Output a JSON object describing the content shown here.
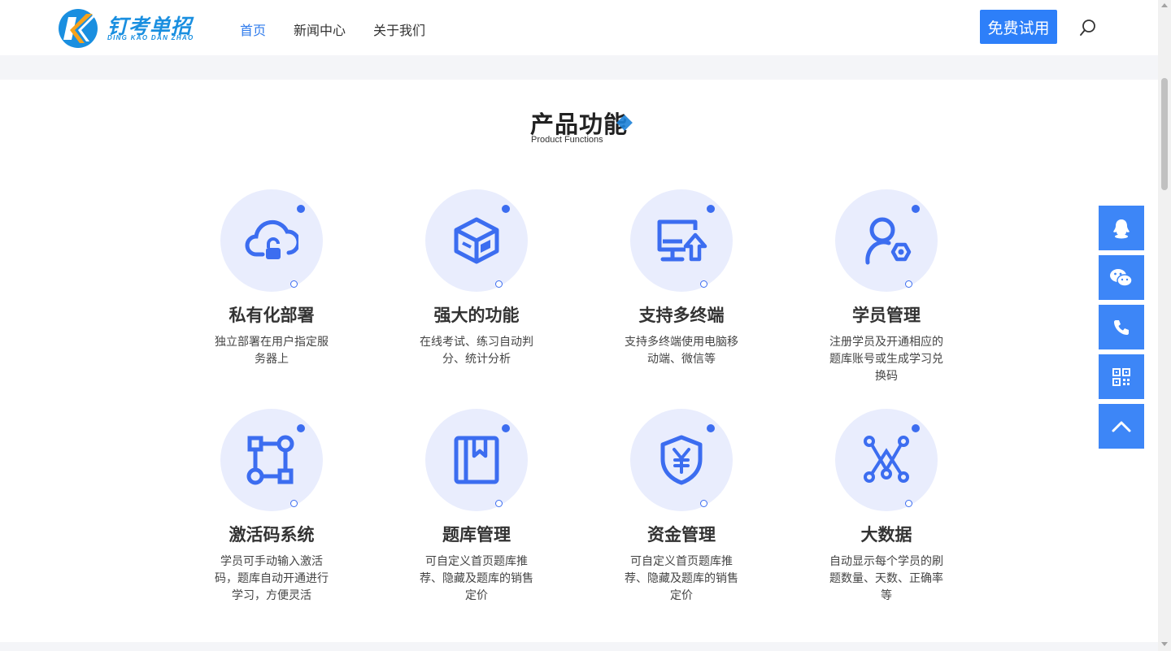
{
  "header": {
    "logo_text": "钉考单招",
    "logo_sub": "DING KAO DAN ZHAO",
    "nav": [
      {
        "label": "首页",
        "active": true
      },
      {
        "label": "新闻中心",
        "active": false
      },
      {
        "label": "关于我们",
        "active": false
      }
    ],
    "trial_label": "免费试用",
    "search_icon": "search-icon"
  },
  "section": {
    "title": "产品功能",
    "subtitle": "Product Functions"
  },
  "features": [
    {
      "title": "私有化部署",
      "desc": "独立部署在用户指定服务器上",
      "icon": "cloud-lock-icon"
    },
    {
      "title": "强大的功能",
      "desc": "在线考试、练习自动判分、统计分析",
      "icon": "cube-icon"
    },
    {
      "title": "支持多终端",
      "desc": "支持多终端使用电脑移动端、微信等",
      "icon": "monitor-upload-icon"
    },
    {
      "title": "学员管理",
      "desc": "注册学员及开通相应的题库账号或生成学习兑换码",
      "icon": "user-settings-icon"
    },
    {
      "title": "激活码系统",
      "desc": "学员可手动输入激活码，题库自动开通进行学习，方便灵活",
      "icon": "node-graph-icon"
    },
    {
      "title": "题库管理",
      "desc": "可自定义首页题库推荐、隐藏及题库的销售定价",
      "icon": "bookmark-book-icon"
    },
    {
      "title": "资金管理",
      "desc": "可自定义首页题库推荐、隐藏及题库的销售定价",
      "icon": "shield-yen-icon"
    },
    {
      "title": "大数据",
      "desc": "自动显示每个学员的刷题数量、天数、正确率等",
      "icon": "network-data-icon"
    }
  ],
  "float_bar": [
    "qq-icon",
    "wechat-icon",
    "phone-icon",
    "qrcode-icon",
    "back-to-top-icon"
  ],
  "colors": {
    "accent": "#2d7ff9",
    "icon": "#3c6df0",
    "circle_bg": "#e9edfd",
    "float_bg": "#3d86f7"
  }
}
